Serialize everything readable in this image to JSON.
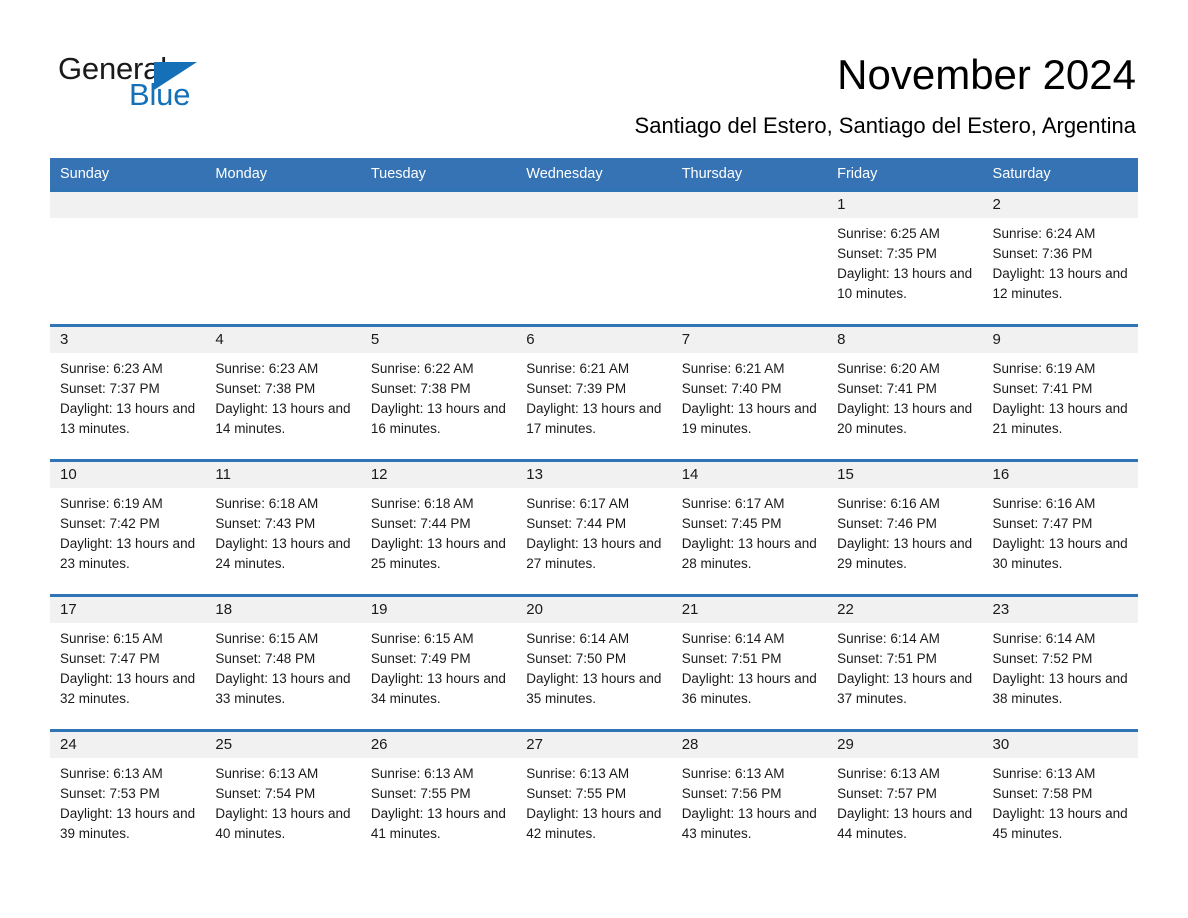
{
  "brand": {
    "name_part1": "General",
    "name_part2": "Blue"
  },
  "header": {
    "month_title": "November 2024",
    "location": "Santiago del Estero, Santiago del Estero, Argentina"
  },
  "colors": {
    "header_blue": "#3573b5",
    "row_rule_blue": "#2f74b5",
    "date_band_gray": "#f1f1f1",
    "logo_blue": "#1570b8"
  },
  "weekday_headers": [
    "Sunday",
    "Monday",
    "Tuesday",
    "Wednesday",
    "Thursday",
    "Friday",
    "Saturday"
  ],
  "weeks": [
    [
      {
        "date": "",
        "sunrise": "",
        "sunset": "",
        "daylight": ""
      },
      {
        "date": "",
        "sunrise": "",
        "sunset": "",
        "daylight": ""
      },
      {
        "date": "",
        "sunrise": "",
        "sunset": "",
        "daylight": ""
      },
      {
        "date": "",
        "sunrise": "",
        "sunset": "",
        "daylight": ""
      },
      {
        "date": "",
        "sunrise": "",
        "sunset": "",
        "daylight": ""
      },
      {
        "date": "1",
        "sunrise": "Sunrise: 6:25 AM",
        "sunset": "Sunset: 7:35 PM",
        "daylight": "Daylight: 13 hours and 10 minutes."
      },
      {
        "date": "2",
        "sunrise": "Sunrise: 6:24 AM",
        "sunset": "Sunset: 7:36 PM",
        "daylight": "Daylight: 13 hours and 12 minutes."
      }
    ],
    [
      {
        "date": "3",
        "sunrise": "Sunrise: 6:23 AM",
        "sunset": "Sunset: 7:37 PM",
        "daylight": "Daylight: 13 hours and 13 minutes."
      },
      {
        "date": "4",
        "sunrise": "Sunrise: 6:23 AM",
        "sunset": "Sunset: 7:38 PM",
        "daylight": "Daylight: 13 hours and 14 minutes."
      },
      {
        "date": "5",
        "sunrise": "Sunrise: 6:22 AM",
        "sunset": "Sunset: 7:38 PM",
        "daylight": "Daylight: 13 hours and 16 minutes."
      },
      {
        "date": "6",
        "sunrise": "Sunrise: 6:21 AM",
        "sunset": "Sunset: 7:39 PM",
        "daylight": "Daylight: 13 hours and 17 minutes."
      },
      {
        "date": "7",
        "sunrise": "Sunrise: 6:21 AM",
        "sunset": "Sunset: 7:40 PM",
        "daylight": "Daylight: 13 hours and 19 minutes."
      },
      {
        "date": "8",
        "sunrise": "Sunrise: 6:20 AM",
        "sunset": "Sunset: 7:41 PM",
        "daylight": "Daylight: 13 hours and 20 minutes."
      },
      {
        "date": "9",
        "sunrise": "Sunrise: 6:19 AM",
        "sunset": "Sunset: 7:41 PM",
        "daylight": "Daylight: 13 hours and 21 minutes."
      }
    ],
    [
      {
        "date": "10",
        "sunrise": "Sunrise: 6:19 AM",
        "sunset": "Sunset: 7:42 PM",
        "daylight": "Daylight: 13 hours and 23 minutes."
      },
      {
        "date": "11",
        "sunrise": "Sunrise: 6:18 AM",
        "sunset": "Sunset: 7:43 PM",
        "daylight": "Daylight: 13 hours and 24 minutes."
      },
      {
        "date": "12",
        "sunrise": "Sunrise: 6:18 AM",
        "sunset": "Sunset: 7:44 PM",
        "daylight": "Daylight: 13 hours and 25 minutes."
      },
      {
        "date": "13",
        "sunrise": "Sunrise: 6:17 AM",
        "sunset": "Sunset: 7:44 PM",
        "daylight": "Daylight: 13 hours and 27 minutes."
      },
      {
        "date": "14",
        "sunrise": "Sunrise: 6:17 AM",
        "sunset": "Sunset: 7:45 PM",
        "daylight": "Daylight: 13 hours and 28 minutes."
      },
      {
        "date": "15",
        "sunrise": "Sunrise: 6:16 AM",
        "sunset": "Sunset: 7:46 PM",
        "daylight": "Daylight: 13 hours and 29 minutes."
      },
      {
        "date": "16",
        "sunrise": "Sunrise: 6:16 AM",
        "sunset": "Sunset: 7:47 PM",
        "daylight": "Daylight: 13 hours and 30 minutes."
      }
    ],
    [
      {
        "date": "17",
        "sunrise": "Sunrise: 6:15 AM",
        "sunset": "Sunset: 7:47 PM",
        "daylight": "Daylight: 13 hours and 32 minutes."
      },
      {
        "date": "18",
        "sunrise": "Sunrise: 6:15 AM",
        "sunset": "Sunset: 7:48 PM",
        "daylight": "Daylight: 13 hours and 33 minutes."
      },
      {
        "date": "19",
        "sunrise": "Sunrise: 6:15 AM",
        "sunset": "Sunset: 7:49 PM",
        "daylight": "Daylight: 13 hours and 34 minutes."
      },
      {
        "date": "20",
        "sunrise": "Sunrise: 6:14 AM",
        "sunset": "Sunset: 7:50 PM",
        "daylight": "Daylight: 13 hours and 35 minutes."
      },
      {
        "date": "21",
        "sunrise": "Sunrise: 6:14 AM",
        "sunset": "Sunset: 7:51 PM",
        "daylight": "Daylight: 13 hours and 36 minutes."
      },
      {
        "date": "22",
        "sunrise": "Sunrise: 6:14 AM",
        "sunset": "Sunset: 7:51 PM",
        "daylight": "Daylight: 13 hours and 37 minutes."
      },
      {
        "date": "23",
        "sunrise": "Sunrise: 6:14 AM",
        "sunset": "Sunset: 7:52 PM",
        "daylight": "Daylight: 13 hours and 38 minutes."
      }
    ],
    [
      {
        "date": "24",
        "sunrise": "Sunrise: 6:13 AM",
        "sunset": "Sunset: 7:53 PM",
        "daylight": "Daylight: 13 hours and 39 minutes."
      },
      {
        "date": "25",
        "sunrise": "Sunrise: 6:13 AM",
        "sunset": "Sunset: 7:54 PM",
        "daylight": "Daylight: 13 hours and 40 minutes."
      },
      {
        "date": "26",
        "sunrise": "Sunrise: 6:13 AM",
        "sunset": "Sunset: 7:55 PM",
        "daylight": "Daylight: 13 hours and 41 minutes."
      },
      {
        "date": "27",
        "sunrise": "Sunrise: 6:13 AM",
        "sunset": "Sunset: 7:55 PM",
        "daylight": "Daylight: 13 hours and 42 minutes."
      },
      {
        "date": "28",
        "sunrise": "Sunrise: 6:13 AM",
        "sunset": "Sunset: 7:56 PM",
        "daylight": "Daylight: 13 hours and 43 minutes."
      },
      {
        "date": "29",
        "sunrise": "Sunrise: 6:13 AM",
        "sunset": "Sunset: 7:57 PM",
        "daylight": "Daylight: 13 hours and 44 minutes."
      },
      {
        "date": "30",
        "sunrise": "Sunrise: 6:13 AM",
        "sunset": "Sunset: 7:58 PM",
        "daylight": "Daylight: 13 hours and 45 minutes."
      }
    ]
  ]
}
